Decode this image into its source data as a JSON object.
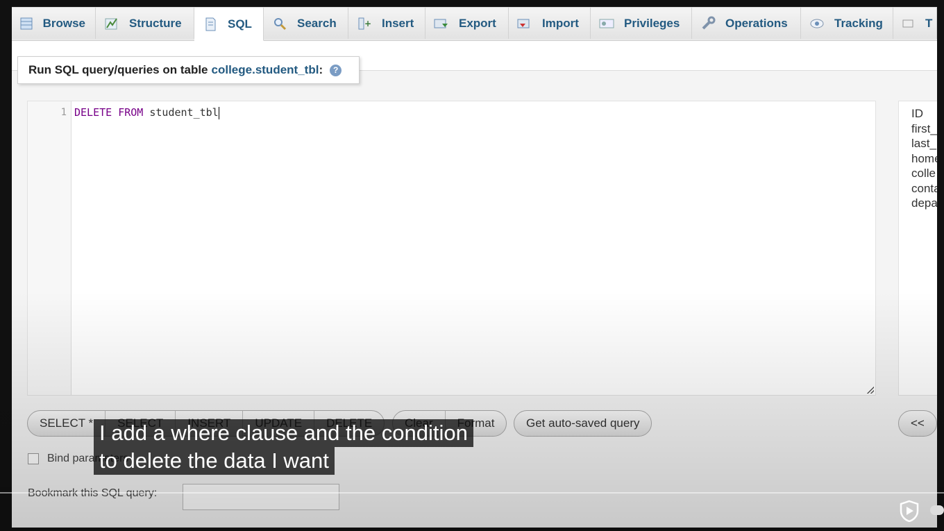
{
  "tabs": [
    {
      "label": "Browse",
      "icon": "table-icon"
    },
    {
      "label": "Structure",
      "icon": "structure-icon"
    },
    {
      "label": "SQL",
      "icon": "sql-icon",
      "active": true
    },
    {
      "label": "Search",
      "icon": "search-icon"
    },
    {
      "label": "Insert",
      "icon": "insert-icon"
    },
    {
      "label": "Export",
      "icon": "export-icon"
    },
    {
      "label": "Import",
      "icon": "import-icon"
    },
    {
      "label": "Privileges",
      "icon": "privileges-icon"
    },
    {
      "label": "Operations",
      "icon": "wrench-icon"
    },
    {
      "label": "Tracking",
      "icon": "eye-icon"
    },
    {
      "label": "T",
      "icon": "triggers-icon"
    }
  ],
  "legend": {
    "prefix": "Run SQL query/queries on table",
    "table_link": "college.student_tbl",
    "suffix": ":",
    "help": "?"
  },
  "editor": {
    "line_number": "1",
    "keyword1": "DELETE",
    "keyword2": "FROM",
    "identifier": "student_tbl"
  },
  "columns": [
    "ID",
    "first_",
    "last_",
    "home",
    "colle",
    "conta",
    "depa"
  ],
  "buttons": {
    "group1": [
      "SELECT *",
      "SELECT",
      "INSERT",
      "UPDATE",
      "DELETE"
    ],
    "group2": [
      "Clear",
      "Format"
    ],
    "auto_saved": "Get auto-saved query",
    "collapse": "<<"
  },
  "bind_params": "Bind parameters",
  "bookmark_label": "Bookmark this SQL query:",
  "caption": {
    "line1": "I add a where clause and the condition",
    "line2": "to delete the data I want"
  },
  "colors": {
    "link": "#235a81",
    "keyword": "#770088"
  }
}
